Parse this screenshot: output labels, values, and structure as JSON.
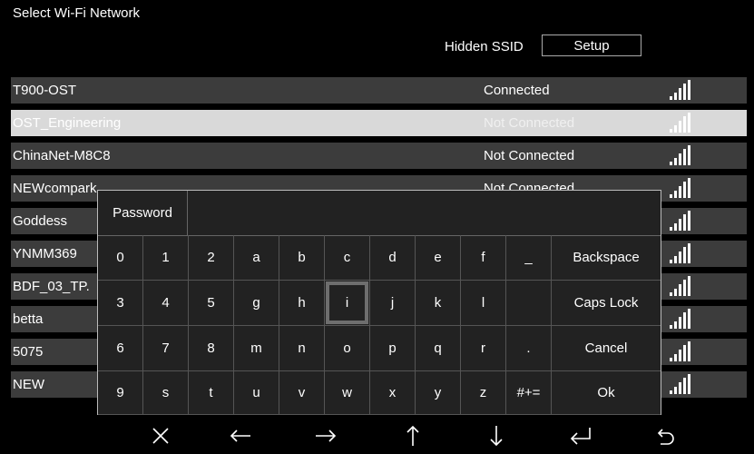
{
  "header": {
    "title": "Select Wi-Fi Network",
    "hidden_ssid_label": "Hidden SSID",
    "setup_label": "Setup"
  },
  "networks": [
    {
      "name": "T900-OST",
      "status": "Connected",
      "selected": false
    },
    {
      "name": "OST_Engineering",
      "status": "Not Connected",
      "selected": true
    },
    {
      "name": "ChinaNet-M8C8",
      "status": "Not Connected",
      "selected": false
    },
    {
      "name": "NEWcompark",
      "status": "Not Connected",
      "selected": false
    },
    {
      "name": "Goddess",
      "status": "",
      "selected": false
    },
    {
      "name": "YNMM369",
      "status": "",
      "selected": false
    },
    {
      "name": "BDF_03_TP.",
      "status": "",
      "selected": false
    },
    {
      "name": "betta",
      "status": "",
      "selected": false
    },
    {
      "name": "5075",
      "status": "",
      "selected": false
    },
    {
      "name": "NEW",
      "status": "",
      "selected": false
    }
  ],
  "keyboard": {
    "password_label": "Password",
    "password_value": "",
    "rows": [
      [
        "0",
        "1",
        "2",
        "a",
        "b",
        "c",
        "d",
        "e",
        "f",
        "_"
      ],
      [
        "3",
        "4",
        "5",
        "g",
        "h",
        "i",
        "j",
        "k",
        "l",
        ""
      ],
      [
        "6",
        "7",
        "8",
        "m",
        "n",
        "o",
        "p",
        "q",
        "r",
        "."
      ],
      [
        "9",
        "s",
        "t",
        "u",
        "v",
        "w",
        "x",
        "y",
        "z",
        "#+="
      ]
    ],
    "actions": [
      "Backspace",
      "Caps Lock",
      "Cancel",
      "Ok"
    ],
    "focused_key": "i"
  },
  "nav": {
    "buttons": [
      "close-icon",
      "arrow-left-icon",
      "arrow-right-icon",
      "arrow-up-icon",
      "arrow-down-icon",
      "enter-icon",
      "back-icon"
    ]
  }
}
